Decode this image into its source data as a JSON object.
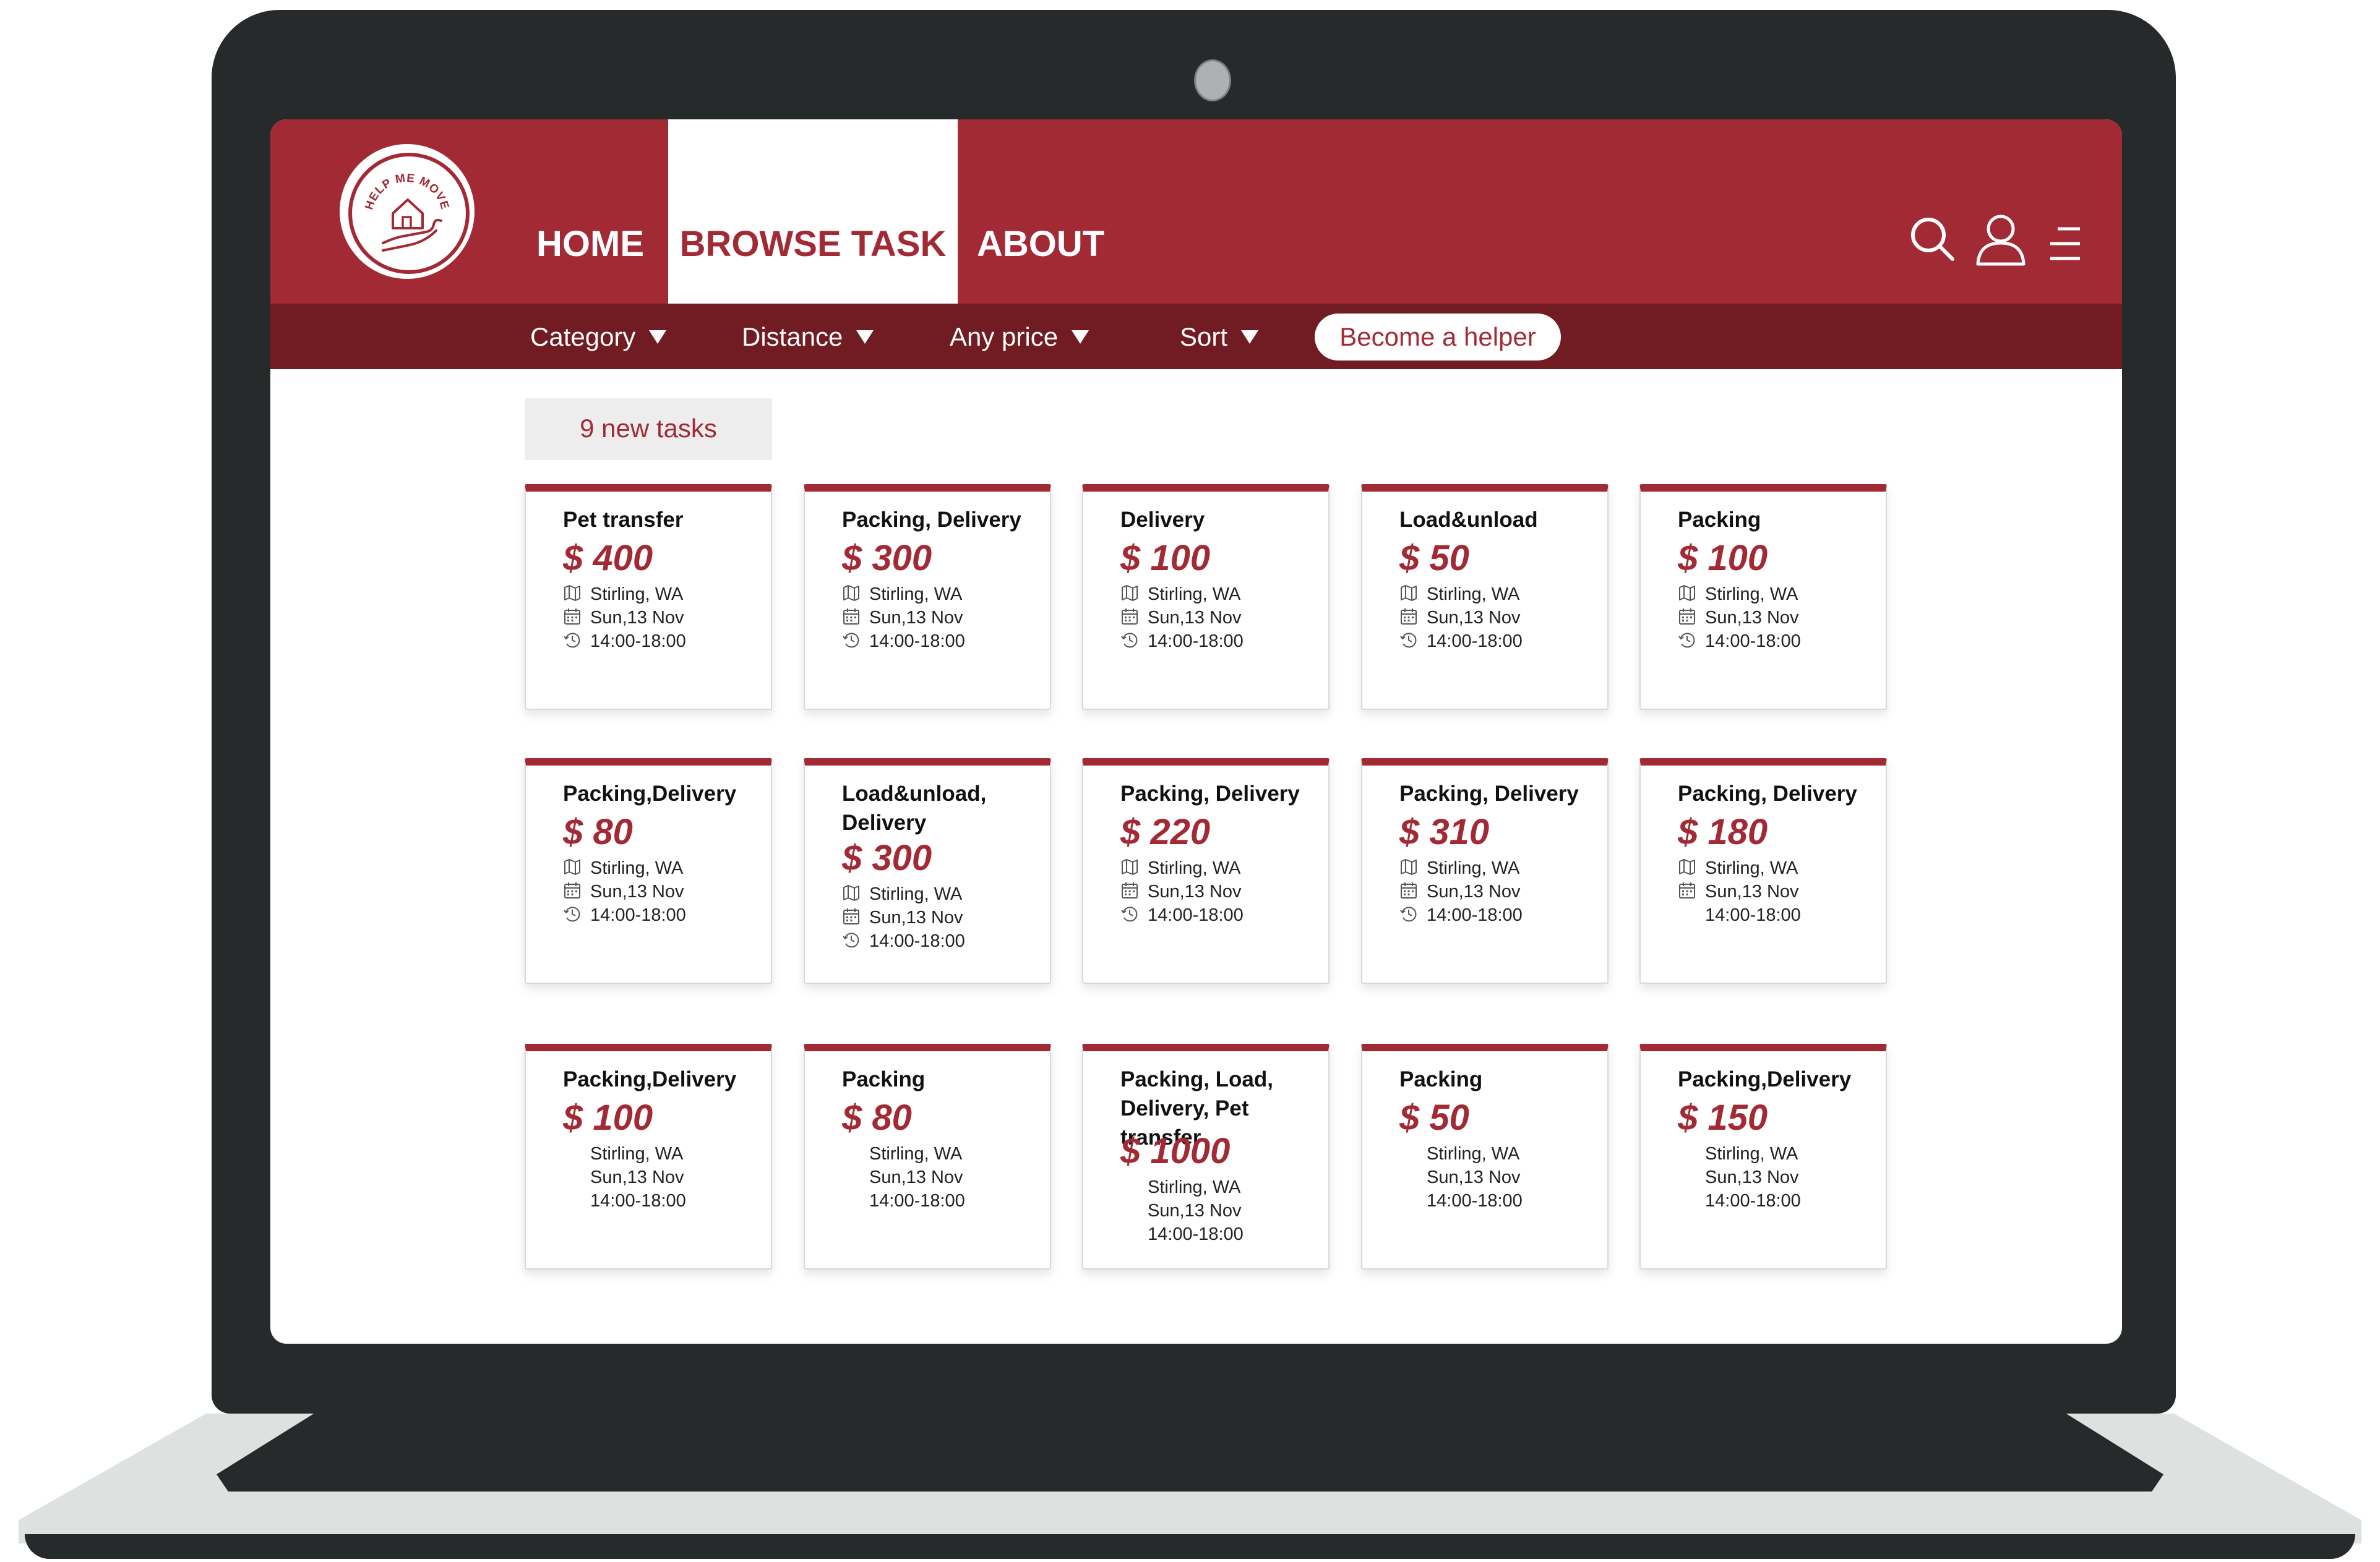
{
  "brand": {
    "logo_text": "HELP ME MOVE"
  },
  "nav": {
    "home": "HOME",
    "browse": "BROWSE TASK",
    "about": "ABOUT",
    "icons": [
      "search-icon",
      "user-icon",
      "menu-icon"
    ]
  },
  "filters": {
    "category": "Category",
    "distance": "Distance",
    "price": "Any price",
    "sort": "Sort",
    "become_helper": "Become a helper"
  },
  "new_tasks": "9 new tasks",
  "colors": {
    "accent": "#a22a35",
    "accent_dark": "#711b22",
    "bezel": "#262a2b"
  },
  "row_icons": [
    "map-icon",
    "calendar-icon",
    "clock-icon"
  ],
  "tasks": [
    {
      "title": "Pet transfer",
      "price": "$ 400",
      "location": "Stirling, WA",
      "date": "Sun,13 Nov",
      "time": "14:00-18:00"
    },
    {
      "title": "Packing, Delivery",
      "price": "$ 300",
      "location": "Stirling, WA",
      "date": "Sun,13 Nov",
      "time": "14:00-18:00"
    },
    {
      "title": "Delivery",
      "price": "$ 100",
      "location": "Stirling, WA",
      "date": "Sun,13 Nov",
      "time": "14:00-18:00"
    },
    {
      "title": "Load&unload",
      "price": "$ 50",
      "location": "Stirling, WA",
      "date": "Sun,13 Nov",
      "time": "14:00-18:00"
    },
    {
      "title": "Packing",
      "price": "$ 100",
      "location": "Stirling, WA",
      "date": "Sun,13 Nov",
      "time": "14:00-18:00"
    },
    {
      "title": "Packing,Delivery",
      "price": "$ 80",
      "location": "Stirling, WA",
      "date": "Sun,13 Nov",
      "time": "14:00-18:00"
    },
    {
      "title": "Load&unload, Delivery",
      "price": "$ 300",
      "location": "Stirling, WA",
      "date": "Sun,13 Nov",
      "time": "14:00-18:00"
    },
    {
      "title": "Packing, Delivery",
      "price": "$ 220",
      "location": "Stirling, WA",
      "date": "Sun,13 Nov",
      "time": "14:00-18:00"
    },
    {
      "title": "Packing, Delivery",
      "price": "$ 310",
      "location": "Stirling, WA",
      "date": "Sun,13 Nov",
      "time": "14:00-18:00"
    },
    {
      "title": "Packing, Delivery",
      "price": "$ 180",
      "location": "Stirling, WA",
      "date": "Sun,13 Nov",
      "time": "14:00-18:00"
    },
    {
      "title": "Packing,Delivery",
      "price": "$ 100",
      "location": "Stirling, WA",
      "date": "Sun,13 Nov",
      "time": "14:00-18:00"
    },
    {
      "title": "Packing",
      "price": "$ 80",
      "location": "Stirling, WA",
      "date": "Sun,13 Nov",
      "time": "14:00-18:00"
    },
    {
      "title": "Packing, Load, Delivery, Pet transfer",
      "price": "$ 1000",
      "location": "Stirling, WA",
      "date": "Sun,13 Nov",
      "time": "14:00-18:00"
    },
    {
      "title": "Packing",
      "price": "$ 50",
      "location": "Stirling, WA",
      "date": "Sun,13 Nov",
      "time": "14:00-18:00"
    },
    {
      "title": "Packing,Delivery",
      "price": "$ 150",
      "location": "Stirling, WA",
      "date": "Sun,13 Nov",
      "time": "14:00-18:00"
    }
  ]
}
